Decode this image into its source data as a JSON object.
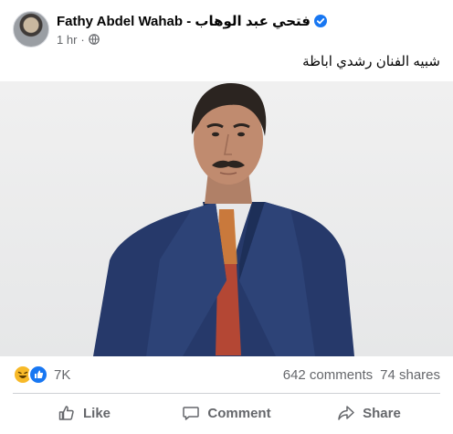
{
  "post": {
    "author": "Fathy Abdel Wahab - فتحي عبد الوهاب",
    "time": "1 hr",
    "separator": "·",
    "caption": "شبيه الفنان رشدي اباظة",
    "icons": {
      "verified": "verified-badge-icon",
      "audience": "globe-icon"
    }
  },
  "stats": {
    "reactions_count": "7K",
    "reaction_icons": [
      "haha-icon",
      "like-icon"
    ],
    "comments": "642 comments",
    "shares": "74 shares"
  },
  "actions": {
    "like": "Like",
    "comment": "Comment",
    "share": "Share"
  },
  "colors": {
    "brand_blue": "#1877f2",
    "secondary_text": "#65676b",
    "divider": "#ced0d4",
    "haha_yellow": "#f7b928"
  }
}
